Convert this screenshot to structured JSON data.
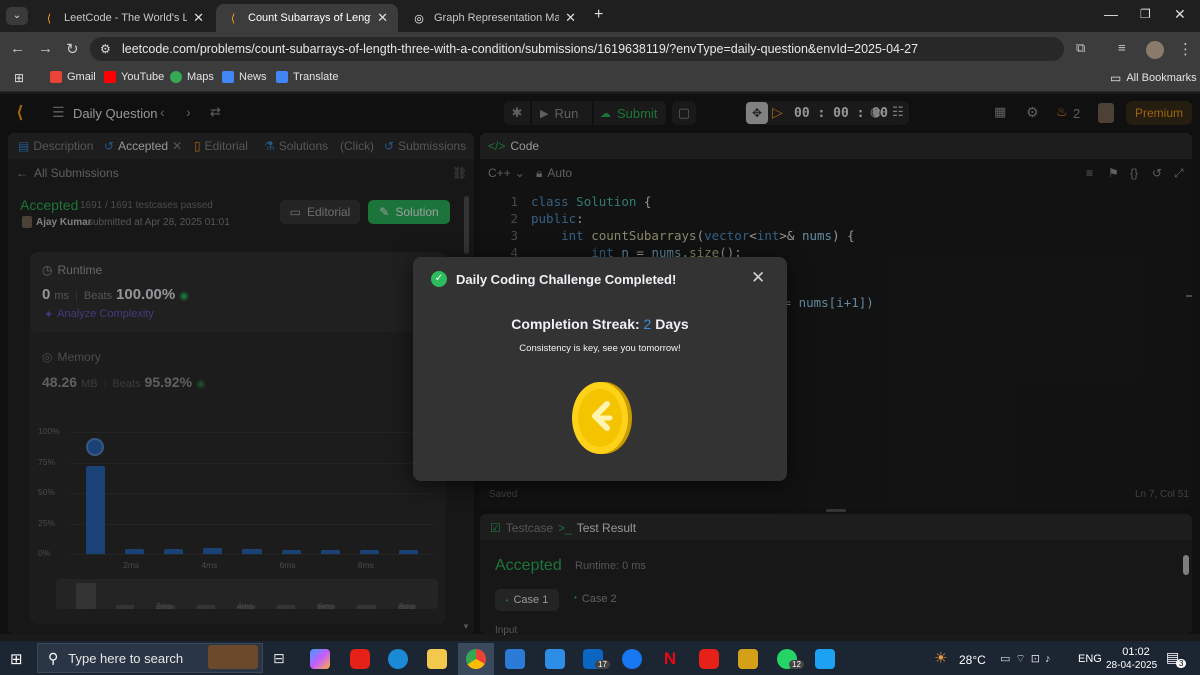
{
  "browser": {
    "tabs": [
      {
        "title": "LeetCode - The World's Leading",
        "active": false
      },
      {
        "title": "Count Subarrays of Length Thre",
        "active": true
      },
      {
        "title": "Graph Representation Matrix",
        "active": false
      }
    ],
    "url": "leetcode.com/problems/count-subarrays-of-length-three-with-a-condition/submissions/1619638119/?envType=daily-question&envId=2025-04-27",
    "bookmarks": [
      "Gmail",
      "YouTube",
      "Maps",
      "News",
      "Translate"
    ],
    "all_bookmarks": "All Bookmarks"
  },
  "header": {
    "daily_question": "Daily Question",
    "run": "Run",
    "submit": "Submit",
    "timer": "00 : 00 : 00",
    "streak_count": "2",
    "premium": "Premium"
  },
  "left": {
    "tabs": [
      "Description",
      "Accepted",
      "Editorial",
      "Solutions",
      "(Click)",
      "Submissions"
    ],
    "back_label": "All Submissions",
    "status": "Accepted",
    "testcases": "1691 / 1691 testcases passed",
    "user": "Ajay Kumar",
    "submitted": "submitted at Apr 28, 2025 01:01",
    "editorial_btn": "Editorial",
    "solution_btn": "Solution",
    "runtime_label": "Runtime",
    "runtime_value": "0",
    "runtime_unit": "ms",
    "runtime_beats_label": "Beats",
    "runtime_beats": "100.00%",
    "analyze": "Analyze Complexity",
    "memory_label": "Memory",
    "memory_value": "48.26",
    "memory_unit": "MB",
    "memory_beats_label": "Beats",
    "memory_beats": "95.92%"
  },
  "chart_data": {
    "type": "bar",
    "y_ticks": [
      "100%",
      "75%",
      "50%",
      "25%",
      "0%"
    ],
    "x_ticks": [
      "2ms",
      "4ms",
      "6ms",
      "8ms"
    ],
    "values": [
      72,
      4,
      4,
      5,
      4,
      3,
      3,
      3,
      3
    ],
    "ylim": [
      0,
      100
    ],
    "mini_x_ticks": [
      "2ms",
      "4ms",
      "6ms",
      "8ms"
    ]
  },
  "code": {
    "title": "Code",
    "language": "C++",
    "mode": "Auto",
    "lines": [
      "1",
      "2",
      "3",
      "4"
    ],
    "line_tail": "== nums[i+1])",
    "saved": "Saved",
    "cursor": "Ln 7, Col 51"
  },
  "result": {
    "tab_testcase": "Testcase",
    "tab_result": "Test Result",
    "status": "Accepted",
    "runtime": "Runtime: 0 ms",
    "case1": "Case 1",
    "case2": "Case 2",
    "input_label": "Input"
  },
  "modal": {
    "title": "Daily Coding Challenge Completed!",
    "streak_label": "Completion Streak:",
    "streak_value": "2",
    "streak_unit": "Days",
    "message": "Consistency is key, see you tomorrow!"
  },
  "taskbar": {
    "search": "Type here to search",
    "temperature": "28°C",
    "language": "ENG",
    "time": "01:02",
    "date": "28-04-2025",
    "linkedin_badge": "17",
    "whatsapp_badge": "12",
    "notif_badge": "3"
  }
}
